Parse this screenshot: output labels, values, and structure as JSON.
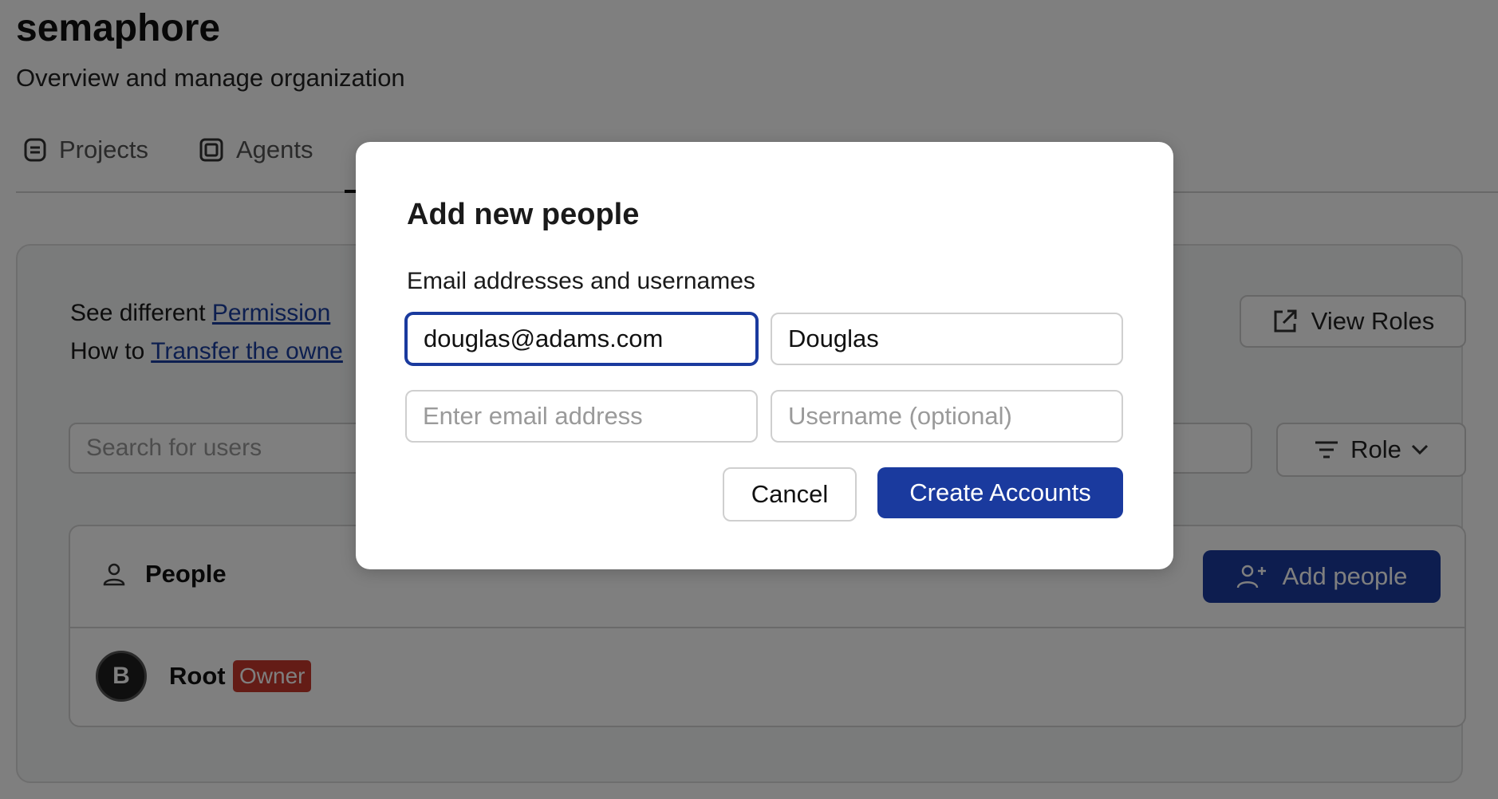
{
  "org": {
    "title": "semaphore",
    "subtitle": "Overview and manage organization"
  },
  "tabs": [
    {
      "label": "Projects",
      "icon": "projects-icon"
    },
    {
      "label": "Agents",
      "icon": "agents-icon"
    }
  ],
  "info": {
    "line1_prefix": "See different",
    "line1_link": "Permission",
    "line2_prefix": "How to",
    "line2_link": "Transfer the owne"
  },
  "toolbar": {
    "view_roles_label": "View Roles",
    "search_placeholder": "Search for users",
    "role_filter_label": "Role"
  },
  "people": {
    "title": "People",
    "add_button_label": "Add people",
    "users": [
      {
        "initial": "B",
        "name": "Root",
        "badge": "Owner"
      }
    ]
  },
  "modal": {
    "title": "Add new people",
    "label": "Email addresses and usernames",
    "rows": [
      {
        "email_value": "douglas@adams.com",
        "username_value": "Douglas"
      },
      {
        "email_placeholder": "Enter email address",
        "username_placeholder": "Username (optional)"
      }
    ],
    "cancel_label": "Cancel",
    "create_label": "Create Accounts"
  },
  "colors": {
    "primary": "#1a3a9e",
    "owner_badge": "#c9382c",
    "overlay": "rgba(0,0,0,0.5)"
  }
}
